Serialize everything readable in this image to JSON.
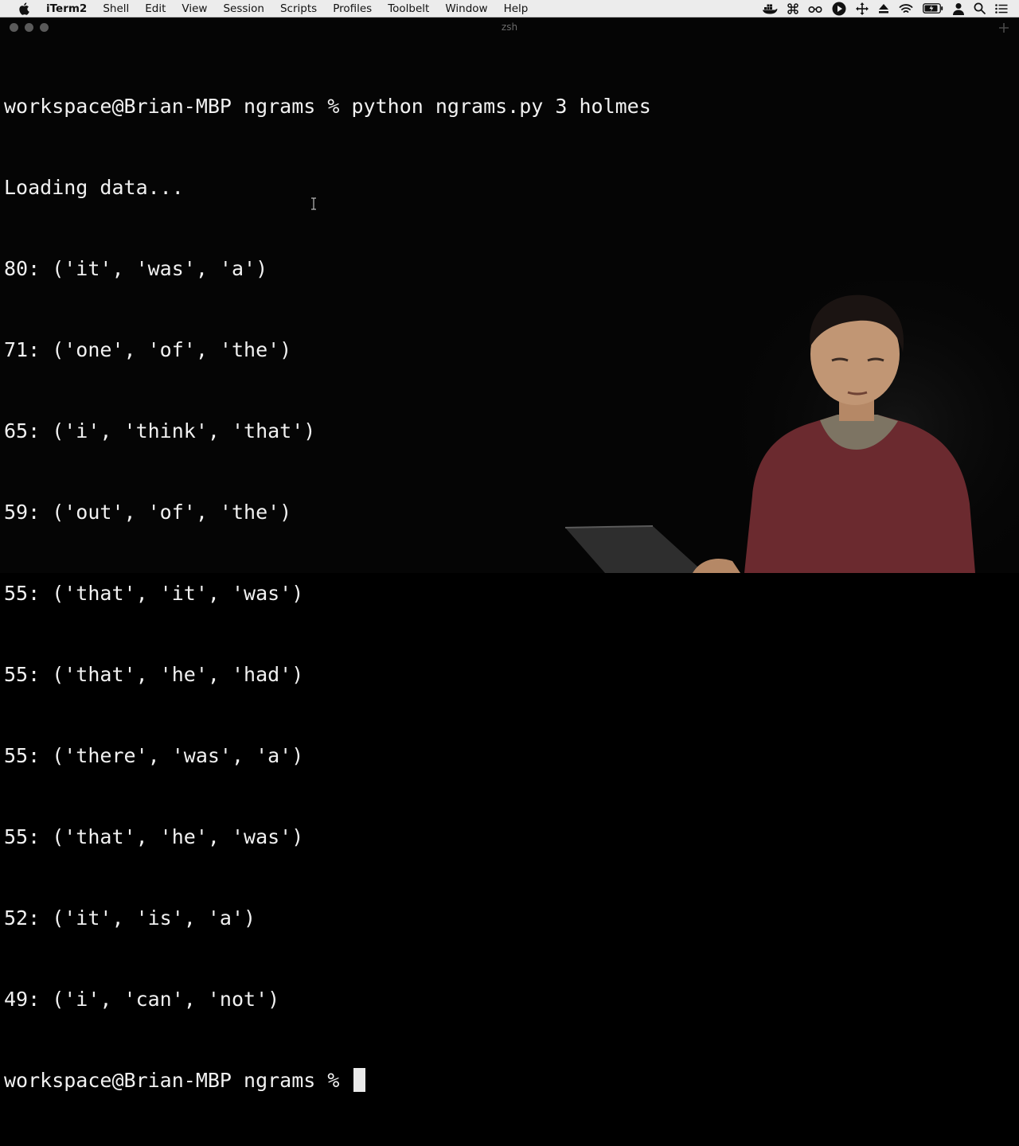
{
  "menubar": {
    "app_name": "iTerm2",
    "items": [
      "Shell",
      "Edit",
      "View",
      "Session",
      "Scripts",
      "Profiles",
      "Toolbelt",
      "Window",
      "Help"
    ],
    "status_icons": [
      "docker-icon",
      "command-icon",
      "glasses-icon",
      "play-circle-icon",
      "move-arrows-icon",
      "eject-icon",
      "wifi-icon",
      "battery-icon",
      "user-icon",
      "search-icon",
      "list-icon"
    ]
  },
  "window": {
    "title": "zsh"
  },
  "terminal": {
    "prompt": "workspace@Brian-MBP ngrams % ",
    "command": "python ngrams.py 3 holmes",
    "status": "Loading data...",
    "results": [
      "80: ('it', 'was', 'a')",
      "71: ('one', 'of', 'the')",
      "65: ('i', 'think', 'that')",
      "59: ('out', 'of', 'the')",
      "55: ('that', 'it', 'was')",
      "55: ('that', 'he', 'had')",
      "55: ('there', 'was', 'a')",
      "55: ('that', 'he', 'was')",
      "52: ('it', 'is', 'a')",
      "49: ('i', 'can', 'not')"
    ],
    "final_prompt": "workspace@Brian-MBP ngrams % "
  },
  "colors": {
    "background": "#050505",
    "text": "#f1f1f1",
    "menubar": "#ececec",
    "presenter_sweater": "#6b2a2f"
  }
}
